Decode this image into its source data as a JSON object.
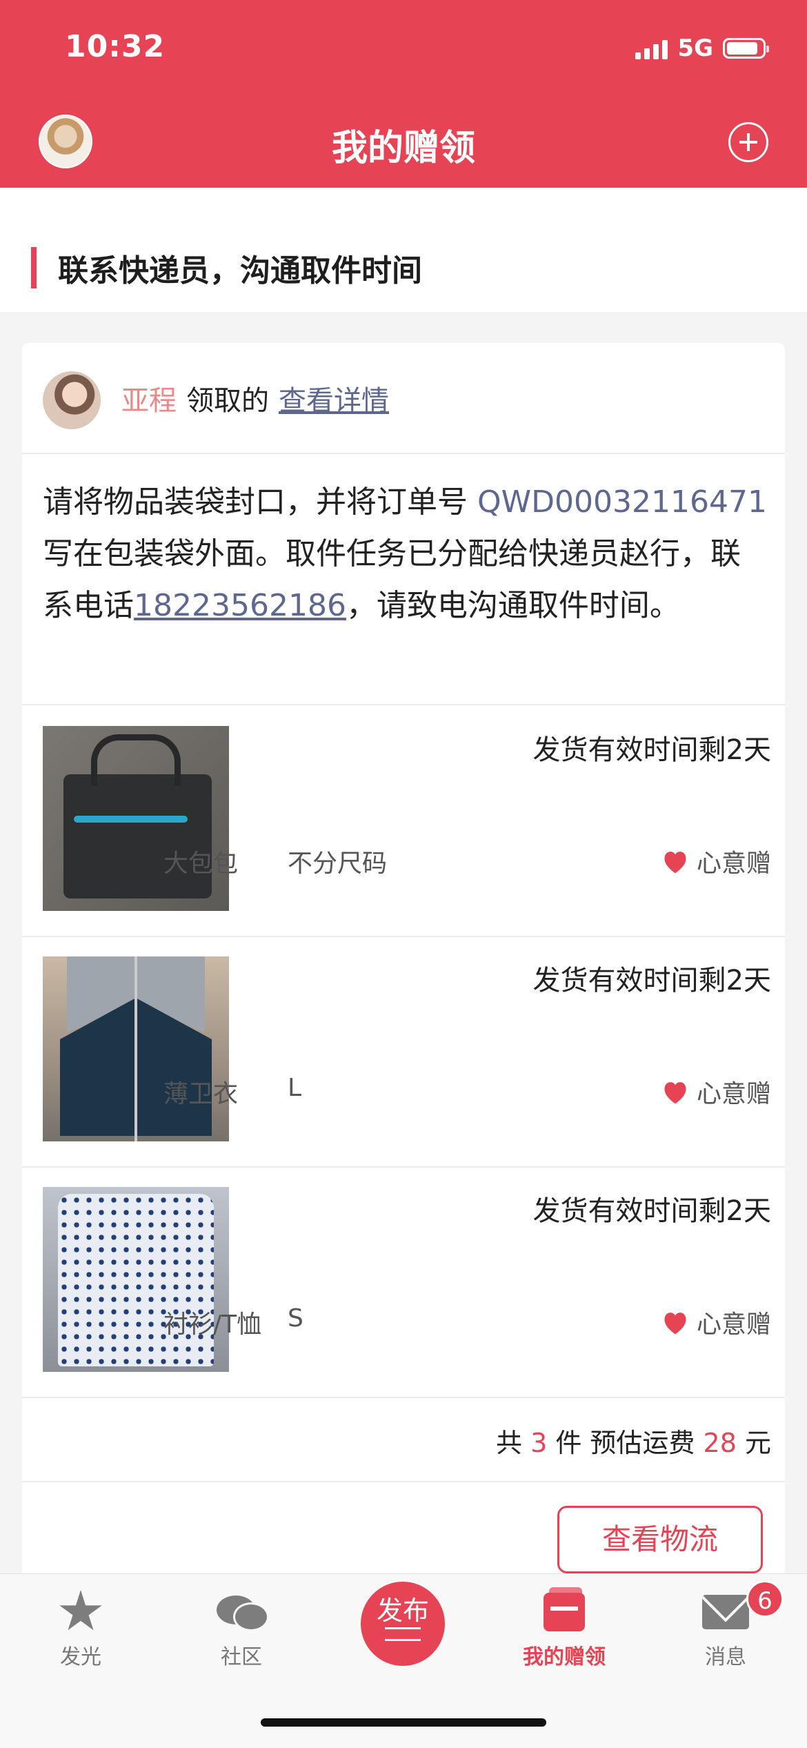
{
  "status_bar": {
    "time": "10:32",
    "network": "5G"
  },
  "nav": {
    "title": "我的赠领"
  },
  "section": {
    "heading": "联系快递员，沟通取件时间"
  },
  "claim": {
    "claimer_name": "亚程",
    "verb": "领取的",
    "detail_link": "查看详情",
    "instruction_part1": "请将物品装袋封口，并将订单号 ",
    "order_number": "QWD00032116471",
    "instruction_part2": " 写在包装袋外面。取件任务已分配给快递员赵行，联系电话",
    "phone": "18223562186",
    "instruction_part3": "，请致电沟通取件时间。"
  },
  "items": [
    {
      "name": "大包包",
      "size": "不分尺码",
      "type": "心意赠",
      "deadline": "发货有效时间剩2天",
      "image": "black-handbag"
    },
    {
      "name": "薄卫衣",
      "size": "L",
      "type": "心意赠",
      "deadline": "发货有效时间剩2天",
      "image": "navy-grey-jacket"
    },
    {
      "name": "衬衫/T恤",
      "size": "S",
      "type": "心意赠",
      "deadline": "发货有效时间剩2天",
      "image": "dotted-shirt"
    }
  ],
  "summary": {
    "prefix": "共",
    "count": "3",
    "count_unit": "件 预估运费",
    "fee": "28",
    "fee_unit": "元"
  },
  "actions": {
    "logistics_button": "查看物流"
  },
  "tabbar": {
    "tabs": [
      {
        "label": "发光",
        "icon": "star-icon"
      },
      {
        "label": "社区",
        "icon": "chat-bubble-icon"
      },
      {
        "label": "发布",
        "icon": "publish-icon"
      },
      {
        "label": "我的赠领",
        "icon": "gift-box-icon"
      },
      {
        "label": "消息",
        "icon": "mail-icon"
      }
    ],
    "message_badge": "6"
  },
  "colors": {
    "accent": "#e64455",
    "link": "#5e6790",
    "claimer_name": "#e98a8a"
  }
}
